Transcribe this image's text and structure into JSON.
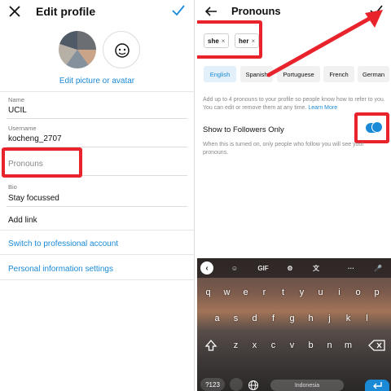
{
  "left": {
    "title": "Edit profile",
    "edit_picture_label": "Edit picture or avatar",
    "fields": {
      "name": {
        "label": "Name",
        "value": "UCIL"
      },
      "username": {
        "label": "Username",
        "value": "kocheng_2707"
      },
      "pronouns": {
        "placeholder": "Pronouns"
      },
      "bio": {
        "label": "Bio",
        "value": "Stay focussed"
      },
      "add_link": "Add link"
    },
    "switch_professional": "Switch to professional account",
    "personal_info": "Personal information settings"
  },
  "right": {
    "title": "Pronouns",
    "selected_pronouns": [
      "she",
      "her"
    ],
    "remove_glyph": "×",
    "languages": [
      {
        "label": "English",
        "selected": true
      },
      {
        "label": "Spanish",
        "selected": false
      },
      {
        "label": "Portuguese",
        "selected": false
      },
      {
        "label": "French",
        "selected": false
      },
      {
        "label": "German",
        "selected": false
      }
    ],
    "help_text": "Add up to 4 pronouns to your profile so people know how to refer to you. You can edit or remove them at any time.",
    "learn_more": "Learn More",
    "show_followers_label": "Show to Followers Only",
    "show_followers_on": true,
    "note_text": "When this is turned on, only people who follow you will see your pronouns."
  },
  "keyboard": {
    "toolbar": [
      "‹",
      "☺",
      "GIF",
      "⚙",
      "文",
      "···",
      "🎤"
    ],
    "rows": [
      [
        "q",
        "w",
        "e",
        "r",
        "t",
        "y",
        "u",
        "i",
        "o",
        "p"
      ],
      [
        "a",
        "s",
        "d",
        "f",
        "g",
        "h",
        "j",
        "k",
        "l"
      ],
      [
        "z",
        "x",
        "c",
        "v",
        "b",
        "n",
        "m"
      ]
    ],
    "number_hints": [
      "1",
      "2",
      "3",
      "4",
      "5",
      "6",
      "7",
      "8",
      "9",
      "0"
    ],
    "mode_key": "?123",
    "space_label": "Indonesia"
  },
  "colors": {
    "accent": "#1b8ad6",
    "annotation": "#e8232b"
  }
}
